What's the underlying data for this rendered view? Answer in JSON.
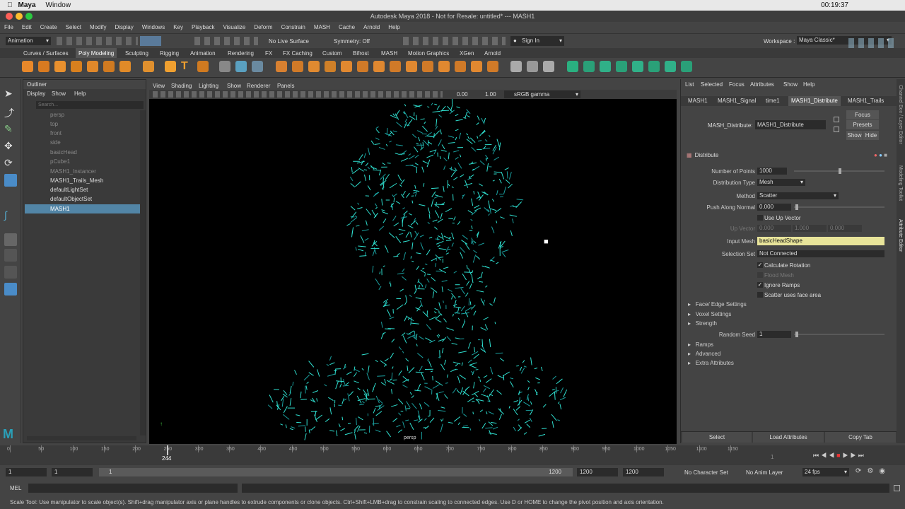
{
  "mac_menubar": {
    "app": "Maya",
    "menu": "Window",
    "time": "00:19:37"
  },
  "window": {
    "title": "Autodesk Maya 2018 - Not for Resale: untitled*   ---   MASH1"
  },
  "menus": [
    "File",
    "Edit",
    "Create",
    "Select",
    "Modify",
    "Display",
    "Windows",
    "Key",
    "Playback",
    "Visualize",
    "Deform",
    "Constrain",
    "MASH",
    "Cache",
    "Arnold",
    "Help"
  ],
  "status": {
    "mode": "Animation",
    "live_surface": "No Live Surface",
    "symmetry": "Symmetry: Off",
    "sign_in": "Sign In",
    "workspace_label": "Workspace :",
    "workspace": "Maya Classic*"
  },
  "shelf_tabs": [
    "Curves / Surfaces",
    "Poly Modeling",
    "Sculpting",
    "Rigging",
    "Animation",
    "Rendering",
    "FX",
    "FX Caching",
    "Custom",
    "Bifrost",
    "MASH",
    "Motion Graphics",
    "XGen",
    "Arnold"
  ],
  "outliner": {
    "title": "Outliner",
    "menu": [
      "Display",
      "Show",
      "Help"
    ],
    "search_placeholder": "Search...",
    "items": [
      "persp",
      "top",
      "front",
      "side",
      "basicHead",
      "pCube1",
      "MASH1_Instancer",
      "MASH1_Trails_Mesh",
      "defaultLightSet",
      "defaultObjectSet",
      "MASH1"
    ]
  },
  "viewport": {
    "menu": [
      "View",
      "Shading",
      "Lighting",
      "Show",
      "Renderer",
      "Panels"
    ],
    "val1": "0.00",
    "val2": "1.00",
    "colorspace": "sRGB gamma",
    "camera": "persp"
  },
  "attribute_editor": {
    "menu": [
      "List",
      "Selected",
      "Focus",
      "Attributes",
      "Show",
      "Help"
    ],
    "tabs": [
      "MASH1",
      "MASH1_Signal",
      "time1",
      "MASH1_Distribute",
      "MASH1_Trails"
    ],
    "node_label": "MASH_Distribute:",
    "node_value": "MASH1_Distribute",
    "focus": "Focus",
    "presets": "Presets",
    "show": "Show",
    "hide": "Hide",
    "section": "Distribute",
    "num_points_label": "Number of Points",
    "num_points": "1000",
    "dist_type_label": "Distribution Type",
    "dist_type": "Mesh",
    "method_label": "Method",
    "method": "Scatter",
    "push_label": "Push Along Normal",
    "push": "0.000",
    "use_up_vector": "Use Up Vector",
    "up_vector_label": "Up Vector",
    "up_x": "0.000",
    "up_y": "1.000",
    "up_z": "0.000",
    "input_mesh_label": "Input Mesh",
    "input_mesh": "basicHeadShape",
    "selection_set_label": "Selection Set",
    "selection_set": "Not Connected",
    "calc_rotation": "Calculate Rotation",
    "flood_mesh": "Flood Mesh",
    "ignore_ramps": "Ignore Ramps",
    "scatter_face": "Scatter uses face area",
    "sections": [
      "Face/ Edge Settings",
      "Voxel Settings",
      "Strength"
    ],
    "random_seed_label": "Random Seed",
    "random_seed": "1",
    "sections2": [
      "Ramps",
      "Advanced",
      "Extra Attributes"
    ],
    "btn_select": "Select",
    "btn_load": "Load Attributes",
    "btn_copy": "Copy Tab"
  },
  "side_tabs": [
    "Channel Box / Layer Editor",
    "Modeling Toolkit",
    "Attribute Editor"
  ],
  "timeline": {
    "ticks": [
      "0",
      "50",
      "100",
      "150",
      "200",
      "250",
      "300",
      "350",
      "400",
      "450",
      "500",
      "550",
      "600",
      "650",
      "700",
      "750",
      "800",
      "850",
      "900",
      "950",
      "1000",
      "1050",
      "1100",
      "1150"
    ],
    "current": "244",
    "end": "1"
  },
  "range": {
    "start": "1",
    "start2": "1",
    "slider_start": "1",
    "slider_end": "1200",
    "end": "1200",
    "end2": "1200",
    "char_set": "No Character Set",
    "anim_layer": "No Anim Layer",
    "fps": "24 fps"
  },
  "cmd": {
    "label": "MEL"
  },
  "help_line": "Scale Tool: Use manipulator to scale object(s). Shift+drag manipulator axis or plane handles to extrude components or clone objects. Ctrl+Shift+LMB+drag to constrain scaling to connected edges. Use D or HOME to change the pivot position and axis orientation."
}
